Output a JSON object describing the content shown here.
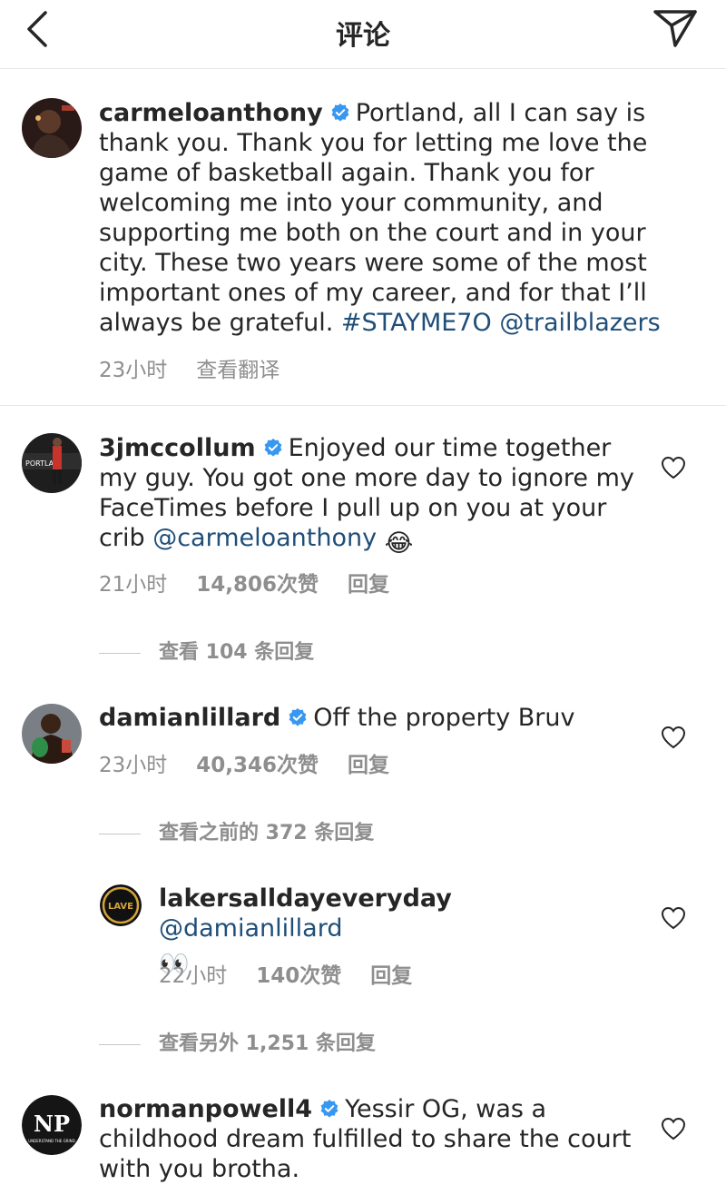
{
  "header": {
    "title": "评论"
  },
  "caption": {
    "username": "carmeloanthony",
    "text": "Portland, all I can say is thank you. Thank you for letting me love the game of basketball again. Thank you for welcoming me into your community, and supporting me both on the court and in your city. These two years were some of the most important ones of my career, and for that I’ll always be grateful.",
    "hashtag": "#STAYME7O",
    "mention": "@trailblazers",
    "time": "23小时",
    "translate_label": "查看翻译"
  },
  "comments": [
    {
      "username": "3jmccollum",
      "text": "Enjoyed our time together my guy. You got one more day to ignore my FaceTimes before I pull up on you at your crib",
      "mention": "@carmeloanthony",
      "emoji": "😂",
      "time": "21小时",
      "likes": "14,806次赞",
      "reply_label": "回复",
      "view_replies": "查看 104 条回复"
    },
    {
      "username": "damianlillard",
      "text": "Off the property Bruv",
      "time": "23小时",
      "likes": "40,346次赞",
      "reply_label": "回复",
      "view_previous": "查看之前的 372 条回复"
    },
    {
      "username": "lakersalldayeveryday",
      "mention": "@damianlillard",
      "emoji": "👀",
      "time": "22小时",
      "likes": "140次赞",
      "reply_label": "回复",
      "view_more": "查看另外 1,251 条回复",
      "avatar_text": "LAVE"
    },
    {
      "username": "normanpowell4",
      "text": "Yessir OG, was a childhood dream fulfilled to share the court with you brotha.",
      "avatar_text": "NP",
      "avatar_subtext": "UNDERSTAND THE GRIND"
    }
  ],
  "colors": {
    "text": "#262626",
    "secondary": "#8e8e8e",
    "link": "#1f4e79",
    "verified": "#3897f0"
  }
}
